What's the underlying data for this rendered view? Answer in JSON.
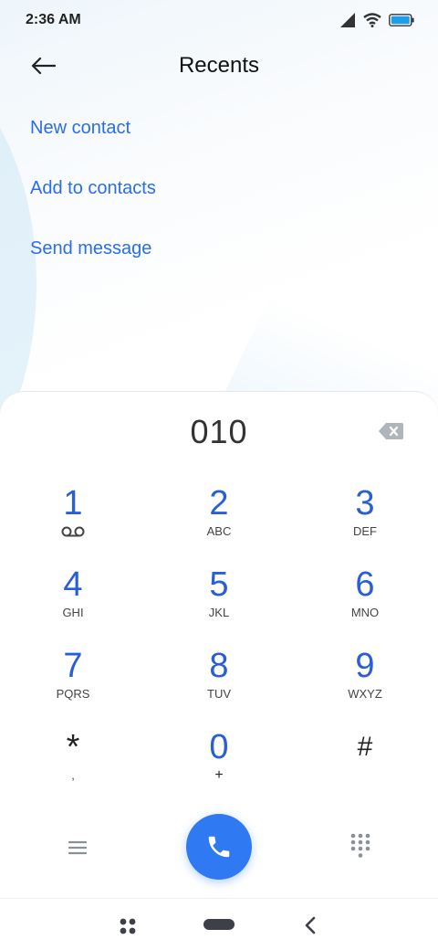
{
  "status_bar": {
    "time": "2:36 AM",
    "icons": [
      "signal-icon",
      "wifi-icon",
      "battery-icon"
    ]
  },
  "header": {
    "title": "Recents",
    "back_icon": "arrow-left-icon"
  },
  "actions": [
    "New contact",
    "Add to contacts",
    "Send message"
  ],
  "dialpad": {
    "number": "010",
    "keys": [
      {
        "digit": "1",
        "letters": "",
        "icon": "voicemail-icon"
      },
      {
        "digit": "2",
        "letters": "ABC"
      },
      {
        "digit": "3",
        "letters": "DEF"
      },
      {
        "digit": "4",
        "letters": "GHI"
      },
      {
        "digit": "5",
        "letters": "JKL"
      },
      {
        "digit": "6",
        "letters": "MNO"
      },
      {
        "digit": "7",
        "letters": "PQRS"
      },
      {
        "digit": "8",
        "letters": "TUV"
      },
      {
        "digit": "9",
        "letters": "WXYZ"
      },
      {
        "digit": "*",
        "letters": ","
      },
      {
        "digit": "0",
        "letters": "+"
      },
      {
        "digit": "#",
        "letters": ""
      }
    ]
  },
  "colors": {
    "accent": "#2a6de8",
    "digit": "#2a5ed6",
    "call_button": "#2f7af3"
  },
  "navbar": {
    "icons": [
      "recents-nav-icon",
      "home-nav-icon",
      "back-nav-icon"
    ]
  }
}
